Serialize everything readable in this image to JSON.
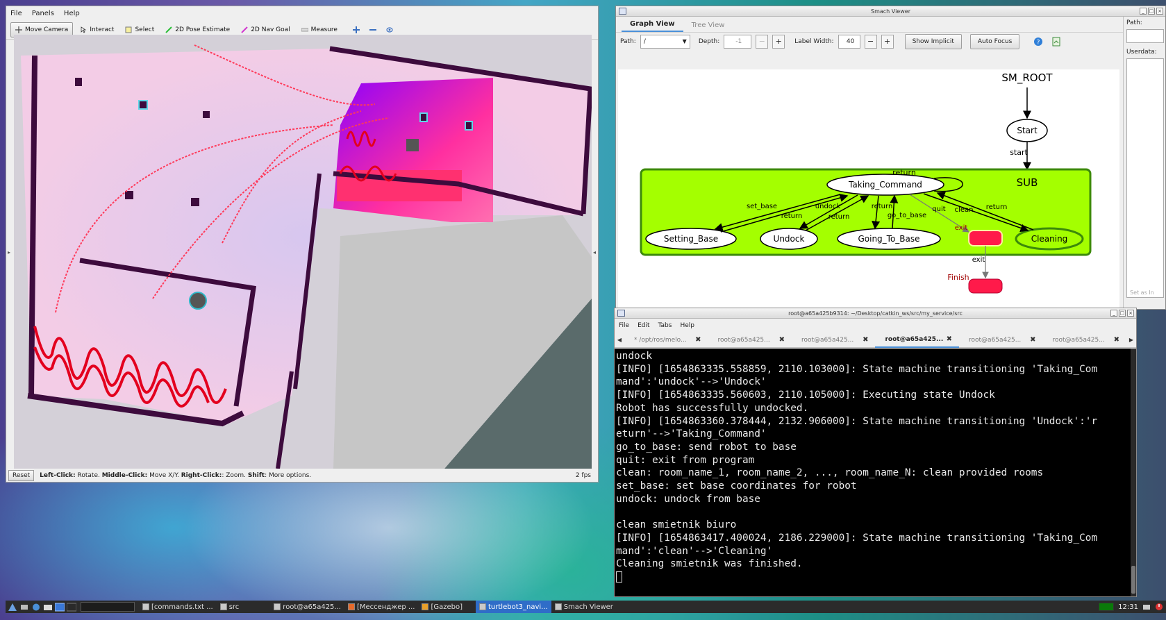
{
  "rviz": {
    "menu": [
      "File",
      "Panels",
      "Help"
    ],
    "tools": [
      {
        "label": "Move Camera",
        "icon": "move-camera-icon",
        "active": true
      },
      {
        "label": "Interact",
        "icon": "interact-icon"
      },
      {
        "label": "Select",
        "icon": "select-icon"
      },
      {
        "label": "2D Pose Estimate",
        "icon": "pose-estimate-icon"
      },
      {
        "label": "2D Nav Goal",
        "icon": "nav-goal-icon"
      },
      {
        "label": "Measure",
        "icon": "measure-icon"
      }
    ],
    "status": {
      "reset": "Reset",
      "left_click": "Left-Click:",
      "left_action": " Rotate. ",
      "middle_click": "Middle-Click:",
      "middle_action": " Move X/Y. ",
      "right_click": "Right-Click:",
      "right_action": ": Zoom. ",
      "shift": "Shift",
      "shift_action": ": More options.",
      "fps": "2 fps"
    }
  },
  "smach": {
    "title": "Smach Viewer",
    "tabs": [
      "Graph View",
      "Tree View"
    ],
    "path_label": "Path:",
    "path_value": "/",
    "depth_label": "Depth:",
    "depth_value": "-1",
    "label_width_label": "Label Width:",
    "label_width_value": "40",
    "show_implicit": "Show Implicit",
    "auto_focus": "Auto Focus",
    "right_path_label": "Path:",
    "userdata_label": "Userdata:",
    "set_as": "Set as In",
    "graph": {
      "root": "SM_ROOT",
      "start": "Start",
      "start_edge": "start",
      "sub": "SUB",
      "taking_command": "Taking_Command",
      "return_top": "return",
      "setting_base": "Setting_Base",
      "undock": "Undock",
      "going_to_base": "Going_To_Base",
      "cleaning": "Cleaning",
      "edge_set_base": "set_base",
      "edge_undock": "undock",
      "edge_return1": "return",
      "edge_return2": "return",
      "edge_return3": "return",
      "edge_go_to_base": "go_to_base",
      "edge_quit": "quit",
      "edge_clean": "clean",
      "edge_return4": "return",
      "edge_exit_in": "exit",
      "edge_exit": "exit",
      "finish": "Finish"
    },
    "colors": {
      "container": "#a4ff00",
      "container_border": "#3c8a0a",
      "terminal": "#ff1a4a"
    }
  },
  "terminal": {
    "title": "root@a65a425b9314: ~/Desktop/catkin_ws/src/my_service/src",
    "menu": [
      "File",
      "Edit",
      "Tabs",
      "Help"
    ],
    "tabs": [
      {
        "label": "* /opt/ros/melo...",
        "active": false
      },
      {
        "label": "root@a65a425...",
        "active": false
      },
      {
        "label": "root@a65a425...",
        "active": false
      },
      {
        "label": "root@a65a425...",
        "active": true
      },
      {
        "label": "root@a65a425...",
        "active": false
      },
      {
        "label": "root@a65a425...",
        "active": false
      }
    ],
    "output": "undock\n[INFO] [1654863335.558859, 2110.103000]: State machine transitioning 'Taking_Com\nmand':'undock'-->'Undock'\n[INFO] [1654863335.560603, 2110.105000]: Executing state Undock\nRobot has successfully undocked.\n[INFO] [1654863360.378444, 2132.906000]: State machine transitioning 'Undock':'r\neturn'-->'Taking_Command'\ngo_to_base: send robot to base\nquit: exit from program\nclean: room_name_1, room_name_2, ..., room_name_N: clean provided rooms\nset_base: set base coordinates for robot\nundock: undock from base\n\nclean smietnik biuro\n[INFO] [1654863417.400024, 2186.229000]: State machine transitioning 'Taking_Com\nmand':'clean'-->'Cleaning'\nCleaning smietnik was finished.\n"
  },
  "taskbar": {
    "items": [
      {
        "label": "[commands.txt ...",
        "active": false
      },
      {
        "label": "src",
        "active": false
      },
      {
        "label": "root@a65a425...",
        "active": false
      },
      {
        "label": "[Мессенджер ...",
        "active": false
      },
      {
        "label": "[Gazebo]",
        "active": false
      },
      {
        "label": "turtlebot3_navi...",
        "active": true
      },
      {
        "label": "Smach Viewer",
        "active": false
      }
    ],
    "clock": "12:31"
  }
}
